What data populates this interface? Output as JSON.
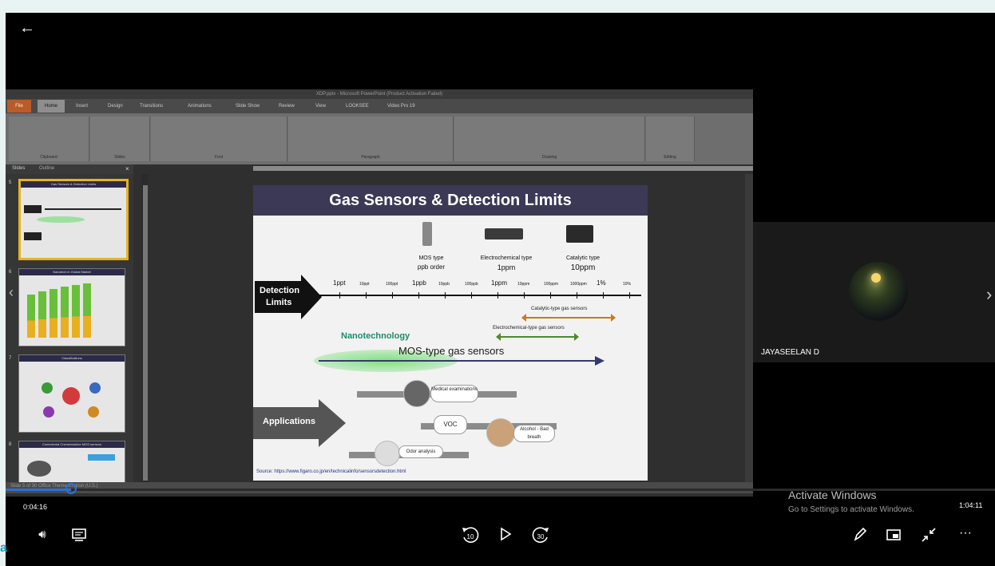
{
  "player": {
    "back_label": "←",
    "time_elapsed": "0:04:16",
    "time_total": "1:04:11",
    "progress_fraction": 0.066
  },
  "powerpoint": {
    "titlebar": "XDP.pptx - Microsoft PowerPoint (Product Activation Failed)",
    "tabs": [
      "File",
      "Home",
      "Insert",
      "Design",
      "Transitions",
      "Animations",
      "Slide Show",
      "Review",
      "View",
      "LOOKSEE",
      "Video Pro 19"
    ],
    "ribbon_groups": [
      "Clipboard",
      "Slides",
      "Font",
      "Paragraph",
      "Drawing",
      "Editing"
    ],
    "panel_tabs": {
      "slides": "Slides",
      "outline": "Outline"
    },
    "thumbnails": [
      {
        "num": "5",
        "title": "Gas Sensors & Detection Limits"
      },
      {
        "num": "6",
        "title": "Nanotech in Global Market"
      },
      {
        "num": "7",
        "title": "Classifications"
      },
      {
        "num": "8",
        "title": "Commercial Chemiresistive MOS sensors"
      }
    ],
    "status": "Slide 5 of 30    Office Theme    English (U.S.)"
  },
  "slide": {
    "title": "Gas Sensors & Detection Limits",
    "sensors": [
      {
        "name": "MOS type",
        "range": "ppb order"
      },
      {
        "name": "Electrochemical type",
        "range": "1ppm"
      },
      {
        "name": "Catalytic type",
        "range": "10ppm"
      }
    ],
    "detection_label_1": "Detection",
    "detection_label_2": "Limits",
    "axis_labels": [
      {
        "text": "1ppt",
        "small": false
      },
      {
        "text": "10ppt",
        "small": true
      },
      {
        "text": "100ppt",
        "small": true
      },
      {
        "text": "1ppb",
        "small": false
      },
      {
        "text": "10ppb",
        "small": true
      },
      {
        "text": "100ppb",
        "small": true
      },
      {
        "text": "1ppm",
        "small": false
      },
      {
        "text": "10ppm",
        "small": true
      },
      {
        "text": "100ppm",
        "small": true
      },
      {
        "text": "1000ppm",
        "small": true
      },
      {
        "text": "1%",
        "small": false
      },
      {
        "text": "10%",
        "small": true
      }
    ],
    "catalytic_label": "Catalytic-type gas sensors",
    "electrochemical_label": "Electrochemical-type gas sensors",
    "nanotech_label": "Nanotechnology",
    "mos_label": "MOS-type gas sensors",
    "applications_label": "Applications",
    "apps": [
      "Medical examinations",
      "VOC",
      "Alcohol - Bad breath",
      "Odor analysis"
    ],
    "source": "Source: https://www.figaro.co.jp/en/technicalinfo/sensorsdetection.html"
  },
  "participant": {
    "name": "JAYASEELAN D"
  },
  "watermark": {
    "title": "Activate Windows",
    "subtitle": "Go to Settings to activate Windows."
  },
  "corner_text": "a",
  "icons": [
    "back-arrow-icon",
    "volume-icon",
    "captions-icon",
    "rewind-10-icon",
    "play-icon",
    "forward-30-icon",
    "pen-icon",
    "picture-in-picture-icon",
    "collapse-icon",
    "more-icon",
    "next-arrow-icon",
    "prev-arrow-icon"
  ],
  "colors": {
    "accent": "#2d6fd6",
    "slide_title_bar": "#3b3956",
    "nanotech": "#1a8c6a",
    "thumb_selected": "#e3b326"
  }
}
